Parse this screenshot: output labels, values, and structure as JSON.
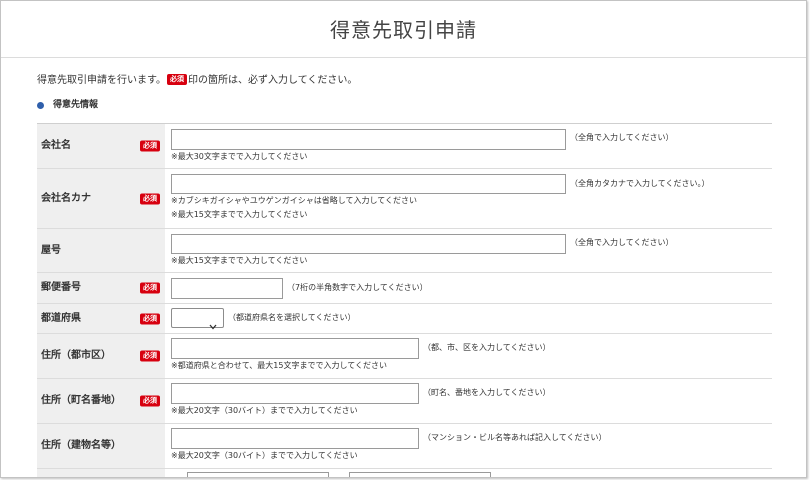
{
  "page": {
    "title": "得意先取引申請"
  },
  "intro": {
    "text_before": "得意先取引申請を行います。",
    "badge": "必須",
    "text_after": "印の箇所は、必ず入力してください。"
  },
  "section": {
    "icon": "bullet-dot-icon",
    "title": "得意先情報"
  },
  "colors": {
    "required_badge": "#d7000f",
    "section_bullet": "#2f5fab",
    "label_background": "#efefef",
    "text": "#333333"
  },
  "form": {
    "required_badge": "必須",
    "fields": [
      {
        "label": "会社名",
        "required": true,
        "value": "",
        "hint": "（全角で入力してください）",
        "notes": [
          "※最大30文字までで入力してください"
        ]
      },
      {
        "label": "会社名カナ",
        "required": true,
        "value": "",
        "hint": "（全角カタカナで入力してください。）",
        "notes": [
          "※カブシキガイシャやユウゲンガイシャは省略して入力してください",
          "※最大15文字までで入力してください"
        ]
      },
      {
        "label": "屋号",
        "required": false,
        "value": "",
        "hint": "（全角で入力してください）",
        "notes": [
          "※最大15文字までで入力してください"
        ]
      },
      {
        "label": "郵便番号",
        "required": true,
        "value": "",
        "hint": "（7桁の半角数字で入力してください）",
        "notes": []
      },
      {
        "label": "都道府県",
        "required": true,
        "value": "",
        "icon": "chevron-down-icon",
        "hint": "（都道府県名を選択してください）",
        "notes": []
      },
      {
        "label": "住所（都市区）",
        "required": true,
        "value": "",
        "hint": "（都、市、区を入力してください）",
        "notes": [
          "※都道府県と合わせて、最大15文字までで入力してください"
        ]
      },
      {
        "label": "住所（町名番地）",
        "required": true,
        "value": "",
        "hint": "（町名、番地を入力してください）",
        "notes": [
          "※最大20文字（30バイト）までで入力してください"
        ]
      },
      {
        "label": "住所（建物名等）",
        "required": false,
        "value": "",
        "hint": "（マンション・ビル名等あれば記入してください）",
        "notes": [
          "※最大20文字（30バイト）までで入力してください"
        ]
      }
    ],
    "partial_row": {
      "inputs": [
        {
          "value": ""
        },
        {
          "value": ""
        }
      ]
    }
  }
}
